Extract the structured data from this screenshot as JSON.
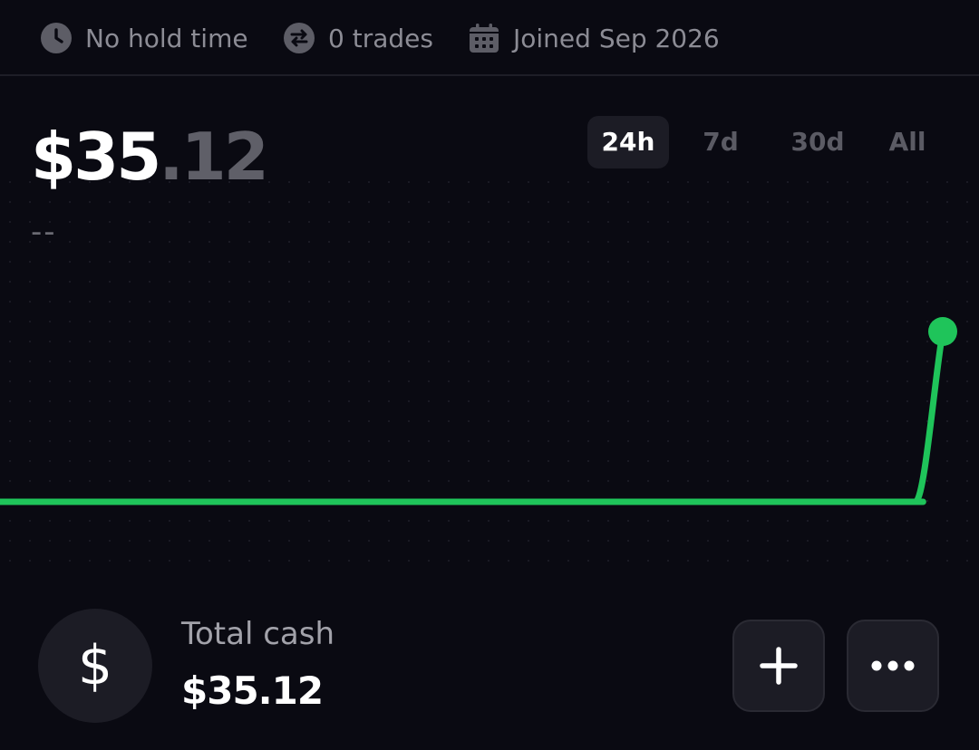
{
  "stats": {
    "hold_time": "No hold time",
    "trades": "0 trades",
    "joined": "Joined Sep 2026",
    "hold_icon": "clock-icon",
    "trades_icon": "swap-arrows-icon",
    "joined_icon": "calendar-icon"
  },
  "balance": {
    "dollars": "$35",
    "cents": ".12",
    "change": "--"
  },
  "tabs": [
    {
      "label": "24h",
      "active": true
    },
    {
      "label": "7d",
      "active": false
    },
    {
      "label": "30d",
      "active": false
    },
    {
      "label": "All",
      "active": false
    }
  ],
  "chart_data": {
    "type": "line",
    "series": [
      {
        "color": "#1fc45a",
        "values": [
          0,
          0,
          0,
          0,
          0,
          0,
          0,
          0,
          0,
          0,
          0,
          0,
          0,
          0,
          0,
          0,
          0,
          0,
          0,
          0,
          0,
          0,
          0,
          0,
          0,
          0,
          0,
          0,
          0,
          0,
          0,
          0,
          0,
          0,
          0,
          0,
          0,
          0,
          0,
          0,
          0,
          0,
          0,
          0,
          0,
          0,
          0,
          0,
          35.12
        ]
      }
    ],
    "ylim": [
      0,
      35.12
    ],
    "grid": true,
    "endpoint_marker": true
  },
  "cash": {
    "icon": "dollar-icon",
    "symbol": "$",
    "label": "Total cash",
    "value": "$35.12"
  },
  "actions": {
    "add_icon": "plus-icon",
    "more_icon": "more-dots-icon"
  },
  "colors": {
    "background": "#0a0a12",
    "accent": "#1fc45a",
    "muted_text": "#8c8c95",
    "surface": "#1c1c25"
  }
}
